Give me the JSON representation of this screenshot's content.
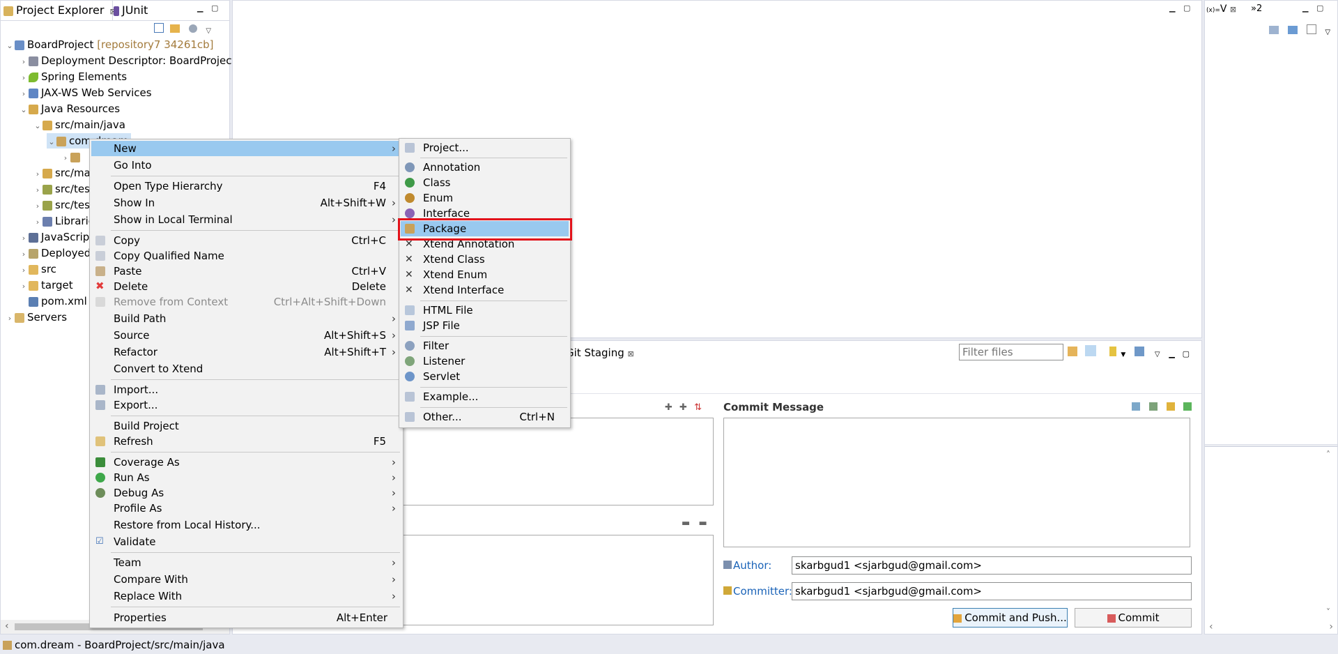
{
  "left_panel": {
    "tabs": [
      {
        "label": "Project Explorer",
        "icon": "project-explorer-icon",
        "close": "⊠"
      },
      {
        "label": "JUnit",
        "icon": "junit-icon"
      }
    ],
    "tree": [
      {
        "label": "BoardProject",
        "suffix": "[repository7 34261cb]",
        "icon": "project-icon"
      },
      {
        "label": "Deployment Descriptor: BoardProject",
        "icon": "descriptor-icon"
      },
      {
        "label": "Spring Elements",
        "icon": "spring-leaf-icon"
      },
      {
        "label": "JAX-WS Web Services",
        "icon": "webservice-icon"
      },
      {
        "label": "Java Resources",
        "icon": "java-resources-icon"
      },
      {
        "label": "src/main/java",
        "icon": "source-folder-icon"
      },
      {
        "label": "com.dream",
        "icon": "package-icon"
      },
      {
        "label": "",
        "icon": "package-icon"
      },
      {
        "label": "src/main/resources",
        "icon": "source-folder-icon"
      },
      {
        "label": "src/test/java",
        "icon": "source-folder-icon"
      },
      {
        "label": "src/test/resources",
        "icon": "source-folder-icon"
      },
      {
        "label": "Libraries",
        "icon": "library-icon"
      },
      {
        "label": "JavaScript Resources",
        "icon": "js-icon"
      },
      {
        "label": "Deployed Resources",
        "icon": "deployed-icon"
      },
      {
        "label": "src",
        "icon": "folder-icon"
      },
      {
        "label": "target",
        "icon": "folder-icon"
      },
      {
        "label": "pom.xml",
        "icon": "xml-file-icon"
      },
      {
        "label": "Servers",
        "icon": "servers-icon"
      }
    ]
  },
  "right_panel": {
    "tabs": [
      {
        "label": "V",
        "prefix": "(x)="
      },
      {
        "label": "»2"
      }
    ]
  },
  "context_menu": {
    "items": [
      {
        "label": "New",
        "shortcut": "",
        "submenu": true,
        "selected": true
      },
      {
        "label": "Go Into",
        "shortcut": ""
      },
      {
        "label": "Open Type Hierarchy",
        "shortcut": "F4"
      },
      {
        "label": "Show In",
        "shortcut": "Alt+Shift+W",
        "submenu": true
      },
      {
        "label": "Show in Local Terminal",
        "shortcut": "",
        "submenu": true
      },
      {
        "label": "Copy",
        "shortcut": "Ctrl+C"
      },
      {
        "label": "Copy Qualified Name",
        "shortcut": ""
      },
      {
        "label": "Paste",
        "shortcut": "Ctrl+V"
      },
      {
        "label": "Delete",
        "shortcut": "Delete"
      },
      {
        "label": "Remove from Context",
        "shortcut": "Ctrl+Alt+Shift+Down",
        "disabled": true
      },
      {
        "label": "Build Path",
        "shortcut": "",
        "submenu": true
      },
      {
        "label": "Source",
        "shortcut": "Alt+Shift+S",
        "submenu": true
      },
      {
        "label": "Refactor",
        "shortcut": "Alt+Shift+T",
        "submenu": true
      },
      {
        "label": "Convert to Xtend",
        "shortcut": ""
      },
      {
        "label": "Import...",
        "shortcut": ""
      },
      {
        "label": "Export...",
        "shortcut": ""
      },
      {
        "label": "Build Project",
        "shortcut": ""
      },
      {
        "label": "Refresh",
        "shortcut": "F5"
      },
      {
        "label": "Coverage As",
        "shortcut": "",
        "submenu": true
      },
      {
        "label": "Run As",
        "shortcut": "",
        "submenu": true
      },
      {
        "label": "Debug As",
        "shortcut": "",
        "submenu": true
      },
      {
        "label": "Profile As",
        "shortcut": "",
        "submenu": true
      },
      {
        "label": "Restore from Local History...",
        "shortcut": ""
      },
      {
        "label": "Validate",
        "shortcut": "",
        "checked": true
      },
      {
        "label": "Team",
        "shortcut": "",
        "submenu": true
      },
      {
        "label": "Compare With",
        "shortcut": "",
        "submenu": true
      },
      {
        "label": "Replace With",
        "shortcut": "",
        "submenu": true
      },
      {
        "label": "Properties",
        "shortcut": "Alt+Enter"
      }
    ]
  },
  "new_submenu": {
    "items": [
      {
        "label": "Project...",
        "icon": "project-wizard-icon"
      },
      {
        "label": "Annotation",
        "icon": "annotation-icon"
      },
      {
        "label": "Class",
        "icon": "class-icon"
      },
      {
        "label": "Enum",
        "icon": "enum-icon"
      },
      {
        "label": "Interface",
        "icon": "interface-icon"
      },
      {
        "label": "Package",
        "icon": "package-icon",
        "selected": true
      },
      {
        "label": "Xtend Annotation",
        "icon": "xtend-icon"
      },
      {
        "label": "Xtend Class",
        "icon": "xtend-icon"
      },
      {
        "label": "Xtend Enum",
        "icon": "xtend-icon"
      },
      {
        "label": "Xtend Interface",
        "icon": "xtend-icon"
      },
      {
        "label": "HTML File",
        "icon": "html-file-icon"
      },
      {
        "label": "JSP File",
        "icon": "jsp-file-icon"
      },
      {
        "label": "Filter",
        "icon": "filter-icon"
      },
      {
        "label": "Listener",
        "icon": "listener-icon"
      },
      {
        "label": "Servlet",
        "icon": "servlet-icon"
      },
      {
        "label": "Example...",
        "icon": "example-icon"
      },
      {
        "label": "Other...",
        "icon": "other-wizard-icon",
        "shortcut": "Ctrl+N"
      }
    ]
  },
  "git_staging": {
    "tab_label": "Git Staging",
    "filter_placeholder": "Filter files",
    "commit_message_label": "Commit Message",
    "author_label": "Author:",
    "author_value": "skarbgud1 <sjarbgud@gmail.com>",
    "committer_label": "Committer:",
    "committer_value": "skarbgud1 <sjarbgud@gmail.com>",
    "commit_and_push_label": "Commit and Push...",
    "commit_label": "Commit"
  },
  "status_bar": {
    "text": "com.dream - BoardProject/src/main/java"
  },
  "colors": {
    "selection": "#99c9ef",
    "highlight_box": "#e2121b",
    "link": "#1a63b8"
  }
}
